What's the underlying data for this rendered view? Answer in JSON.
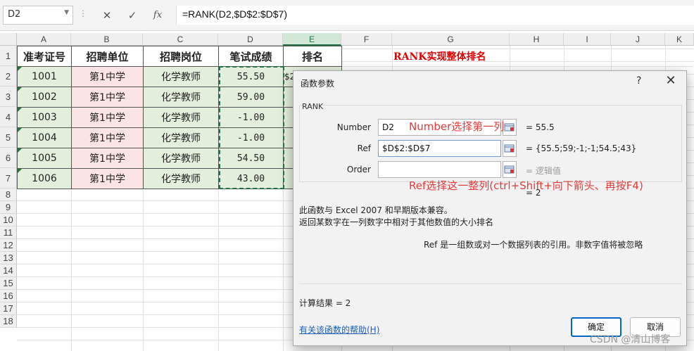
{
  "formula_bar": {
    "name_box": "D2",
    "cancel_glyph": "✕",
    "enter_glyph": "✓",
    "fx_glyph": "fx",
    "formula": "=RANK(D2,$D$2:$D$7)"
  },
  "grid": {
    "columns": [
      "A",
      "B",
      "C",
      "D",
      "E",
      "F",
      "G",
      "H",
      "I",
      "J",
      "K"
    ],
    "selected_column": "E",
    "rows": [
      "1",
      "2",
      "3",
      "4",
      "5",
      "6",
      "7",
      "8",
      "9",
      "10",
      "11",
      "12",
      "13",
      "14",
      "15",
      "16",
      "17",
      "18"
    ],
    "headers": [
      "准考证号",
      "招聘单位",
      "招聘岗位",
      "笔试成绩",
      "排名"
    ],
    "data_rows": [
      [
        "1001",
        "第1中学",
        "化学教师",
        "55.50"
      ],
      [
        "1002",
        "第1中学",
        "化学教师",
        "59.00"
      ],
      [
        "1003",
        "第1中学",
        "化学教师",
        "-1.00"
      ],
      [
        "1004",
        "第1中学",
        "化学教师",
        "-1.00"
      ],
      [
        "1005",
        "第1中学",
        "化学教师",
        "54.50"
      ],
      [
        "1006",
        "第1中学",
        "化学教师",
        "43.00"
      ]
    ],
    "e2_partial": "$2",
    "sheet_title": "RANK实现整体排名"
  },
  "dialog": {
    "title": "函数参数",
    "help_glyph": "?",
    "close_glyph": "✕",
    "function_name": "RANK",
    "args": [
      {
        "label": "Number",
        "value": "D2",
        "result": "=  55.5"
      },
      {
        "label": "Ref",
        "value": "$D$2:$D$7",
        "result": "=  {55.5;59;-1;-1;54.5;43}"
      },
      {
        "label": "Order",
        "value": "",
        "result": "=  逻辑值"
      }
    ],
    "annotation_number": "Number选择第一列",
    "annotation_ref": "Ref选择这一整列(ctrl+Shift+向下箭头、再按F4)",
    "formula_result": "=  2",
    "description_1": "此函数与 Excel 2007 和早期版本兼容。",
    "description_2": "返回某数字在一列数字中相对于其他数值的大小排名",
    "param_help": "Ref  是一组数或对一个数据列表的引用。非数字值将被忽略",
    "calc_label": "计算结果 =  2",
    "help_link": "有关该函数的帮助(H)",
    "ok_label": "确定",
    "cancel_label": "取消"
  },
  "watermark": "CSDN @清山博客",
  "colors": {
    "accent": "#217346",
    "annotation": "#e53b3b",
    "title_red": "#e00000",
    "green_fill": "#e2efda",
    "pink_fill": "#fce4e4"
  }
}
